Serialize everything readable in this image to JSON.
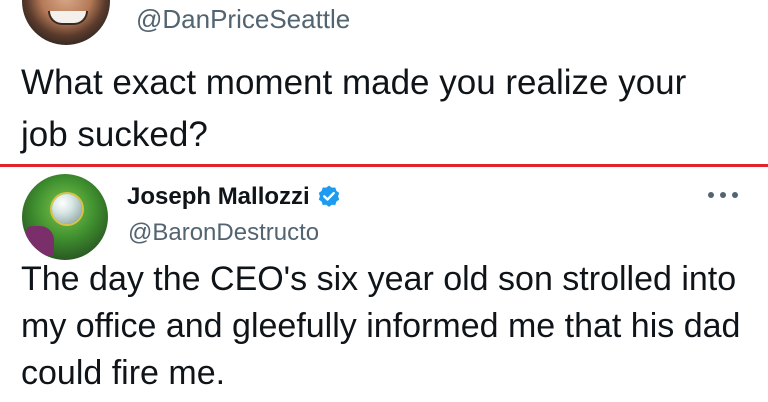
{
  "top_tweet": {
    "handle": "@DanPriceSeattle",
    "text": "What exact moment made you realize your job sucked?",
    "avatar_icon": "profile-photo-icon"
  },
  "reply_tweet": {
    "display_name": "Joseph Mallozzi",
    "handle": "@BaronDestructo",
    "text": "The day the CEO's six year old son strolled into my office and gleefully informed me that his dad could fire me.",
    "avatar_icon": "profile-photo-icon",
    "verified_icon": "verified-badge-icon",
    "more_icon": "more-options-icon"
  },
  "colors": {
    "divider": "#e0242c",
    "text": "#0f1419",
    "secondary_text": "#536471",
    "verified_blue": "#1d9bf0"
  }
}
